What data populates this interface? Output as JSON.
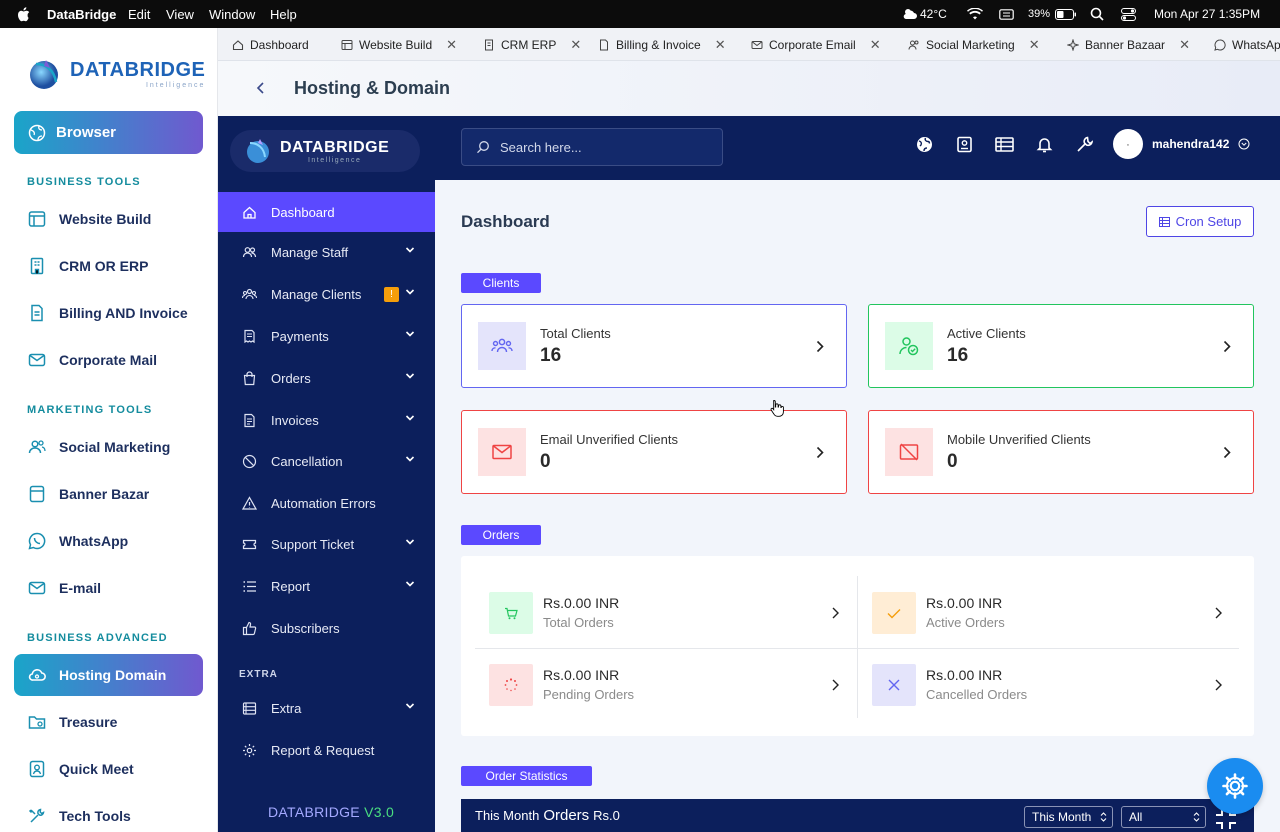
{
  "menubar": {
    "app": "DataBridge",
    "menus": [
      "Edit",
      "View",
      "Window",
      "Help"
    ],
    "weather": "42°C",
    "battery": "39%",
    "datetime": "Mon Apr 27  1:35PM"
  },
  "left_sidebar": {
    "logo_name": "DATABRIDGE",
    "logo_sub": "Intelligence",
    "browser_label": "Browser",
    "sections": [
      {
        "title": "BUSINESS TOOLS",
        "items": [
          {
            "label": "Website Build",
            "icon": "website-icon"
          },
          {
            "label": "CRM OR ERP",
            "icon": "building-icon"
          },
          {
            "label": "Billing AND  Invoice",
            "icon": "document-icon"
          },
          {
            "label": "Corporate Mail",
            "icon": "mail-icon"
          }
        ]
      },
      {
        "title": "MARKETING TOOLS",
        "items": [
          {
            "label": "Social Marketing",
            "icon": "users-icon"
          },
          {
            "label": "Banner Bazar",
            "icon": "banner-icon"
          },
          {
            "label": "WhatsApp",
            "icon": "whatsapp-icon"
          },
          {
            "label": "E-mail",
            "icon": "mail-icon"
          }
        ]
      },
      {
        "title": "BUSINESS ADVANCED",
        "items": [
          {
            "label": "Hosting Domain",
            "icon": "cloud-icon",
            "active": true
          },
          {
            "label": "Treasure",
            "icon": "folder-icon"
          },
          {
            "label": "Quick Meet",
            "icon": "video-icon"
          },
          {
            "label": "Tech Tools",
            "icon": "tools-icon"
          }
        ]
      }
    ]
  },
  "tabs": [
    {
      "label": "Dashboard",
      "closable": false
    },
    {
      "label": "Website Build",
      "closable": true
    },
    {
      "label": "CRM ERP",
      "closable": true
    },
    {
      "label": "Billing & Invoice",
      "closable": true
    },
    {
      "label": "Corporate Email",
      "closable": true
    },
    {
      "label": "Social Marketing",
      "closable": true
    },
    {
      "label": "Banner Bazaar",
      "closable": true
    },
    {
      "label": "WhatsAp",
      "closable": false
    }
  ],
  "header": {
    "title": "Hosting & Domain"
  },
  "dash_sidebar": {
    "logo_name": "DATABRIDGE",
    "logo_sub": "Intelligence",
    "items": [
      {
        "label": "Dashboard",
        "active": true,
        "caret": false
      },
      {
        "label": "Manage Staff",
        "caret": true
      },
      {
        "label": "Manage Clients",
        "caret": true,
        "badge": "!"
      },
      {
        "label": "Payments",
        "caret": true
      },
      {
        "label": "Orders",
        "caret": true
      },
      {
        "label": "Invoices",
        "caret": true
      },
      {
        "label": "Cancellation",
        "caret": true
      },
      {
        "label": "Automation Errors",
        "caret": false
      },
      {
        "label": "Support Ticket",
        "caret": true
      },
      {
        "label": "Report",
        "caret": true
      },
      {
        "label": "Subscribers",
        "caret": false
      }
    ],
    "extra_title": "EXTRA",
    "extra_items": [
      {
        "label": "Extra",
        "caret": true
      },
      {
        "label": "Report & Request",
        "caret": false
      }
    ],
    "version_brand": "DATABRIDGE",
    "version": "V3.0"
  },
  "topbar": {
    "search_placeholder": "Search here...",
    "username": "mahendra142"
  },
  "main": {
    "title": "Dashboard",
    "cron_label": "Cron Setup",
    "clients_label": "Clients",
    "client_cards": [
      {
        "label": "Total Clients",
        "value": "16",
        "color": "#6366f1",
        "bg": "#e4e4fb"
      },
      {
        "label": "Active Clients",
        "value": "16",
        "color": "#22c55e",
        "bg": "#dcfce7"
      },
      {
        "label": "Email Unverified Clients",
        "value": "0",
        "color": "#ef4444",
        "bg": "#fde2e2"
      },
      {
        "label": "Mobile Unverified Clients",
        "value": "0",
        "color": "#ef4444",
        "bg": "#fde2e2"
      }
    ],
    "orders_label": "Orders",
    "orders": [
      {
        "amount": "Rs.0.00 INR",
        "label": "Total Orders",
        "bg": "#dcfce7"
      },
      {
        "amount": "Rs.0.00 INR",
        "label": "Active Orders",
        "bg": "#ffedd5"
      },
      {
        "amount": "Rs.0.00 INR",
        "label": "Pending Orders",
        "bg": "#fde2e2"
      },
      {
        "amount": "Rs.0.00 INR",
        "label": "Cancelled Orders",
        "bg": "#e4e4fb"
      }
    ],
    "stats_label": "Order Statistics",
    "stats_bar": {
      "prefix": "This Month",
      "mid": "Orders",
      "amount": "Rs.0",
      "period": "This Month",
      "filter": "All"
    }
  }
}
